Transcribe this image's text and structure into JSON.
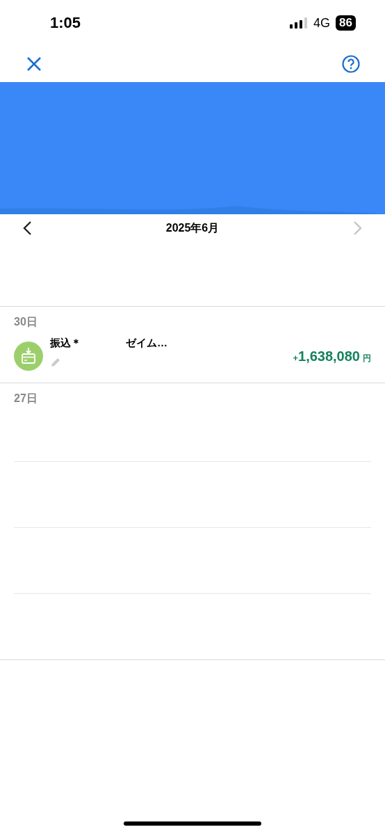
{
  "status_bar": {
    "time": "1:05",
    "network": "4G",
    "battery": "86"
  },
  "month_nav": {
    "title": "2025年6月",
    "next_disabled": true
  },
  "days": [
    {
      "label": "30日",
      "transactions": [
        {
          "kind": "income",
          "name": "振込＊",
          "payee": "ゼイム…",
          "sign": "+",
          "amount": "1,638,080",
          "currency": "円"
        }
      ]
    },
    {
      "label": "27日"
    }
  ]
}
